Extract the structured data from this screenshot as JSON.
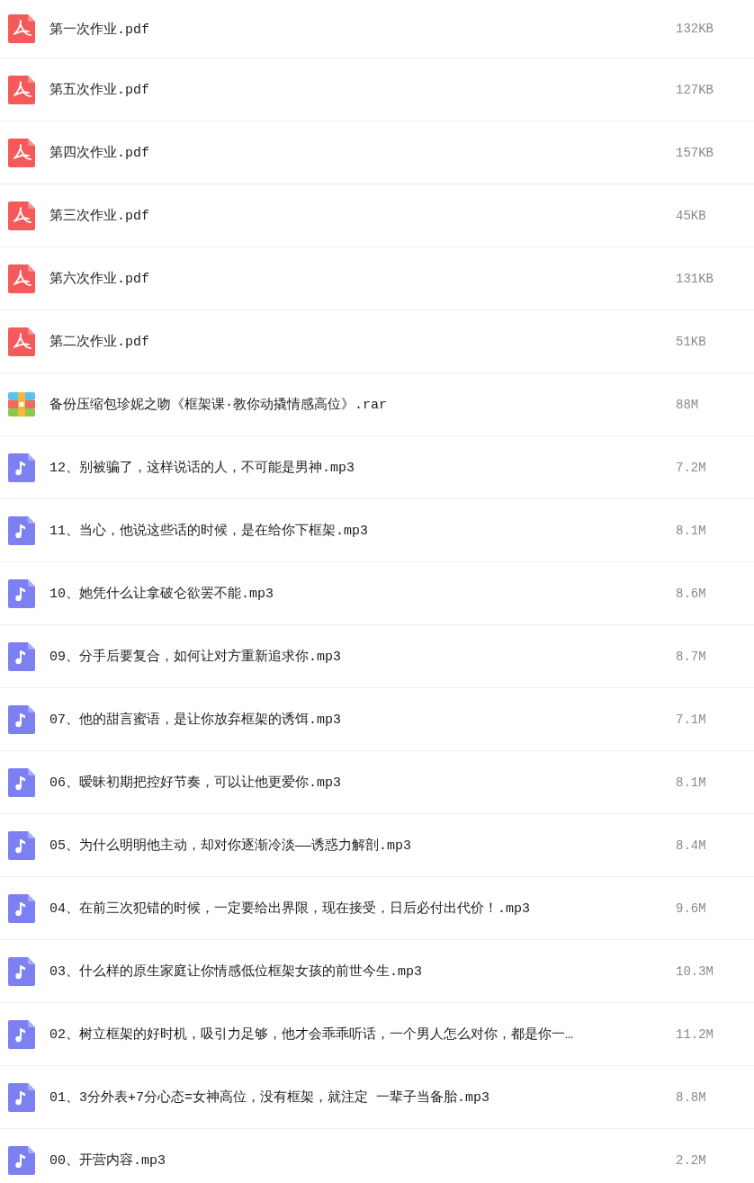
{
  "files": [
    {
      "kind": "pdf",
      "name": "第一次作业.pdf",
      "size": "132KB"
    },
    {
      "kind": "pdf",
      "name": "第五次作业.pdf",
      "size": "127KB"
    },
    {
      "kind": "pdf",
      "name": "第四次作业.pdf",
      "size": "157KB"
    },
    {
      "kind": "pdf",
      "name": "第三次作业.pdf",
      "size": "45KB"
    },
    {
      "kind": "pdf",
      "name": "第六次作业.pdf",
      "size": "131KB"
    },
    {
      "kind": "pdf",
      "name": "第二次作业.pdf",
      "size": "51KB"
    },
    {
      "kind": "rar",
      "name": "备份压缩包珍妮之吻《框架课·教你动撬情感高位》.rar",
      "size": "88M"
    },
    {
      "kind": "mp3",
      "name": "12、别被骗了，这样说话的人，不可能是男神.mp3",
      "size": "7.2M"
    },
    {
      "kind": "mp3",
      "name": "11、当心，他说这些话的时候，是在给你下框架.mp3",
      "size": "8.1M"
    },
    {
      "kind": "mp3",
      "name": "10、她凭什么让拿破仑欲罢不能.mp3",
      "size": "8.6M"
    },
    {
      "kind": "mp3",
      "name": "09、分手后要复合，如何让对方重新追求你.mp3",
      "size": "8.7M"
    },
    {
      "kind": "mp3",
      "name": "07、他的甜言蜜语，是让你放弃框架的诱饵.mp3",
      "size": "7.1M"
    },
    {
      "kind": "mp3",
      "name": "06、暧昧初期把控好节奏，可以让他更爱你.mp3",
      "size": "8.1M"
    },
    {
      "kind": "mp3",
      "name": "05、为什么明明他主动，却对你逐渐冷淡——诱惑力解剖.mp3",
      "size": "8.4M"
    },
    {
      "kind": "mp3",
      "name": "04、在前三次犯错的时候，一定要给出界限，现在接受，日后必付出代价！.mp3",
      "size": "9.6M"
    },
    {
      "kind": "mp3",
      "name": "03、什么样的原生家庭让你情感低位框架女孩的前世今生.mp3",
      "size": "10.3M"
    },
    {
      "kind": "mp3",
      "name": "02、树立框架的好时机，吸引力足够，他才会乖乖听话，一个男人怎么对你，都是你一…",
      "size": "11.2M"
    },
    {
      "kind": "mp3",
      "name": "01、3分外表+7分心态=女神高位，没有框架，就注定 一辈子当备胎.mp3",
      "size": "8.8M"
    },
    {
      "kind": "mp3",
      "name": "00、开营内容.mp3",
      "size": "2.2M"
    }
  ]
}
